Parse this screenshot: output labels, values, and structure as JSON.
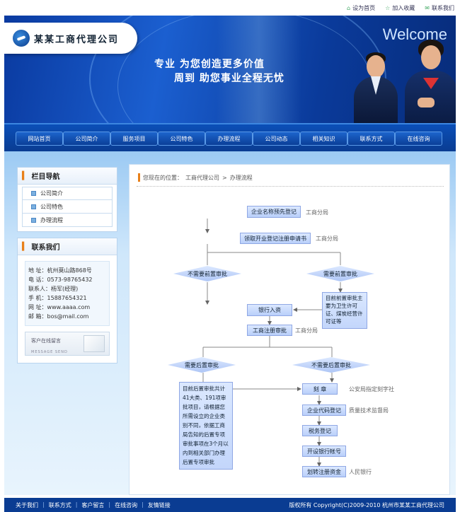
{
  "toplinks": {
    "home": "设为首页",
    "fav": "加入收藏",
    "contact": "联系我们"
  },
  "header": {
    "company": "某某工商代理公司",
    "welcome": "Welcome",
    "slogan1": "专业  为您创造更多价值",
    "slogan2": "周到  助您事业全程无忧"
  },
  "nav": {
    "items": [
      "网站首页",
      "公司简介",
      "服务项目",
      "公司特色",
      "办理流程",
      "公司动态",
      "相关知识",
      "联系方式",
      "在线咨询"
    ]
  },
  "sidebar": {
    "nav_title": "栏目导航",
    "menu": [
      "公司简介",
      "公司特色",
      "办理流程"
    ],
    "contact_title": "联系我们",
    "address": "地  址：杭州莫山路868号",
    "phone": "电  话：0573-98765432",
    "person": "联系人：杨军(经理)",
    "mobile": "手  机：15887654321",
    "web": "网  址：www.aaaa.com",
    "email": "邮  箱：bos@mail.com",
    "msg_label": "客户在线留言",
    "msg_sub": "MESSAGE SEND"
  },
  "breadcrumb": {
    "prefix": "您现在的位置：",
    "home": "工商代理公司",
    "sep": " > ",
    "current": "办理流程"
  },
  "flow": {
    "step1": "企业名称预先登记",
    "step1_note": "工商分局",
    "step2": "领取开业登记注册申请书",
    "step2_note": "工商分局",
    "d_no_pre": "不需要前置审批",
    "d_need_pre": "需要前置审批",
    "pre_items": "目前前置审批主要为卫生许可证、煤炭经营许可证等",
    "bank": "银行入资",
    "reg": "工商注册审批",
    "reg_note": "工商分局",
    "d_need_post": "需要后置审批",
    "d_no_post": "不需要后置审批",
    "post_text": "目前后置审批共计41大类、191项审批项目，请根据您所需设立的企业类别不同，依据工商局告知的后置专项审批事项在3个月以内到相关部门办理后置专项审批",
    "seal": "刻    章",
    "seal_note": "公安局指定刻字社",
    "code": "企业代码登记",
    "code_note": "质量技术监督局",
    "tax": "税务登记",
    "account": "开设银行帐号",
    "transfer": "划转注册资金",
    "transfer_note": "人民银行"
  },
  "footer": {
    "links": [
      "关于我们",
      "联系方式",
      "客户留言",
      "在线咨询",
      "友情链接"
    ],
    "copyright": "版权所有  Copyright(C)2009-2010 杭州市某某工商代理公司"
  },
  "colors": {
    "brand": "#0a3c92",
    "accent": "#e8801a",
    "box": "#b9cffa"
  }
}
